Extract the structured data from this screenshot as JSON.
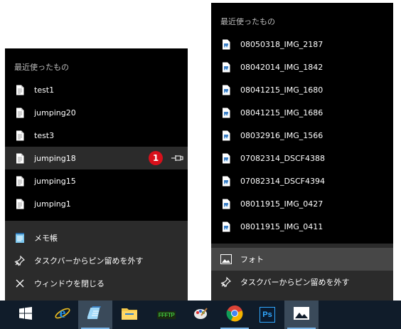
{
  "left_jumplist": {
    "header": "最近使ったもの",
    "items": [
      {
        "label": "test1",
        "icon": "document-icon"
      },
      {
        "label": "jumping20",
        "icon": "document-icon"
      },
      {
        "label": "test3",
        "icon": "document-icon"
      },
      {
        "label": "jumping18",
        "icon": "document-icon"
      },
      {
        "label": "jumping15",
        "icon": "document-icon"
      },
      {
        "label": "jumping1",
        "icon": "document-icon"
      }
    ],
    "badge": "1",
    "tasks": [
      {
        "label": "メモ帳",
        "icon": "notepad-icon"
      },
      {
        "label": "タスクバーからピン留めを外す",
        "icon": "unpin-icon"
      },
      {
        "label": "ウィンドウを閉じる",
        "icon": "close-icon"
      }
    ]
  },
  "right_jumplist": {
    "header": "最近使ったもの",
    "items": [
      {
        "label": "08050318_IMG_2187",
        "icon": "image-file-icon"
      },
      {
        "label": "08042014_IMG_1842",
        "icon": "image-file-icon"
      },
      {
        "label": "08041215_IMG_1680",
        "icon": "image-file-icon"
      },
      {
        "label": "08041215_IMG_1686",
        "icon": "image-file-icon"
      },
      {
        "label": "08032916_IMG_1566",
        "icon": "image-file-icon"
      },
      {
        "label": "07082314_DSCF4388",
        "icon": "image-file-icon"
      },
      {
        "label": "07082314_DSCF4394",
        "icon": "image-file-icon"
      },
      {
        "label": "08011915_IMG_0427",
        "icon": "image-file-icon"
      },
      {
        "label": "08011915_IMG_0411",
        "icon": "image-file-icon"
      }
    ],
    "tasks": [
      {
        "label": "フォト",
        "icon": "photos-icon"
      },
      {
        "label": "タスクバーからピン留めを外す",
        "icon": "unpin-icon"
      }
    ]
  },
  "taskbar": {
    "icons": [
      "start-icon",
      "internet-explorer-icon",
      "notepad-icon",
      "file-explorer-icon",
      "ftp-icon",
      "paint-icon",
      "chrome-icon",
      "photoshop-icon",
      "photos-icon"
    ],
    "ps_label": "Ps",
    "ftp_label": "FFFTP"
  },
  "colors": {
    "menu_bg": "#000000",
    "tasks_bg": "#2b2b2b",
    "hover": "#474747",
    "taskbar_bg": "#101c2a",
    "badge": "#d8101b"
  }
}
